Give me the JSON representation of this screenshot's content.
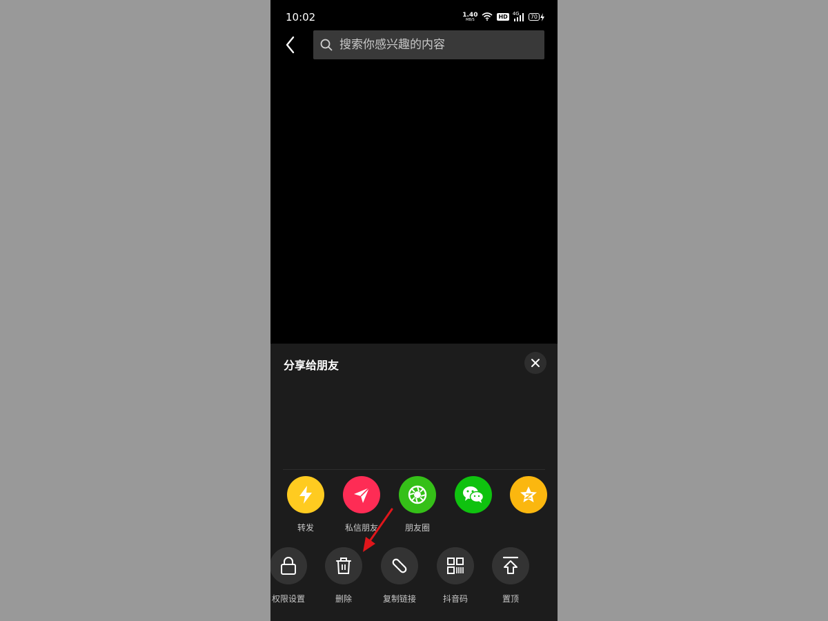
{
  "status_bar": {
    "time": "10:02",
    "net_speed_value": "1.40",
    "net_speed_unit": "MB/S",
    "hd": "HD",
    "network": "4G",
    "battery": "70"
  },
  "search": {
    "placeholder": "搜索你感兴趣的内容"
  },
  "sheet": {
    "title": "分享给朋友",
    "share_targets": [
      {
        "label": "转发",
        "icon": "lightning-icon",
        "color": "#FFCB20"
      },
      {
        "label": "私信朋友",
        "icon": "paper-plane-icon",
        "color": "#FE2C55"
      },
      {
        "label": "朋友圈",
        "icon": "moments-icon",
        "color": "#35C018"
      },
      {
        "label": "",
        "icon": "wechat-icon",
        "color": "#0FC20F"
      },
      {
        "label": "",
        "icon": "qzone-star-icon",
        "color": "#FBB70F"
      }
    ],
    "actions": [
      {
        "label": "权限设置",
        "icon": "lock-icon"
      },
      {
        "label": "删除",
        "icon": "trash-icon"
      },
      {
        "label": "复制链接",
        "icon": "link-icon"
      },
      {
        "label": "抖音码",
        "icon": "qr-code-icon"
      },
      {
        "label": "置顶",
        "icon": "pin-to-top-icon"
      }
    ]
  }
}
